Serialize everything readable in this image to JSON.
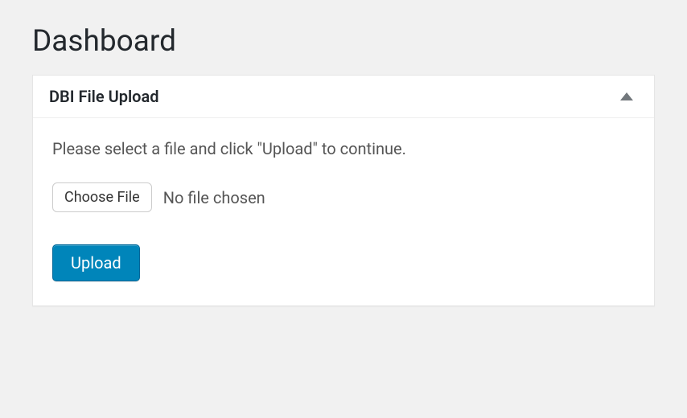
{
  "page": {
    "title": "Dashboard"
  },
  "widget": {
    "title": "DBI File Upload",
    "instruction": "Please select a file and click \"Upload\" to continue.",
    "choose_file_label": "Choose File",
    "file_status": "No file chosen",
    "upload_label": "Upload"
  }
}
